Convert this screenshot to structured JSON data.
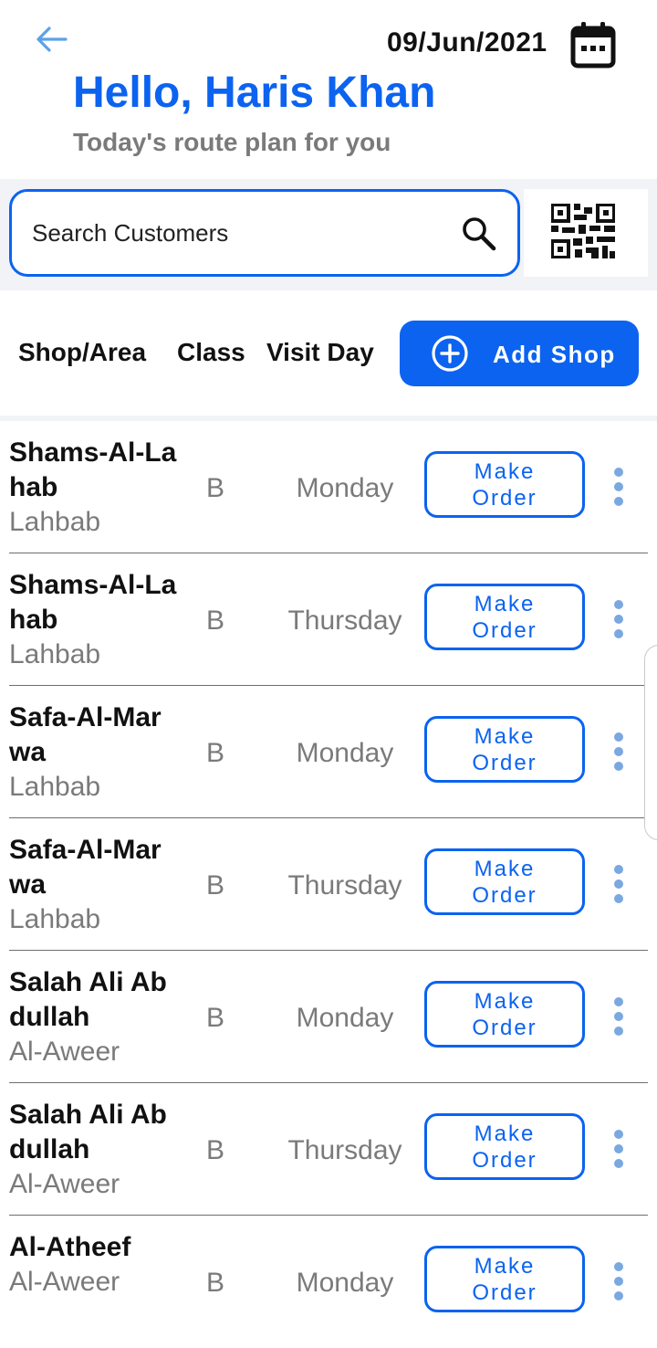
{
  "header": {
    "date": "09/Jun/2021",
    "greeting": "Hello, Haris Khan",
    "subtitle": "Today's route plan for you"
  },
  "search": {
    "placeholder": "Search Customers",
    "value": ""
  },
  "columns": {
    "shop": "Shop/Area",
    "class": "Class",
    "visit_day": "Visit Day"
  },
  "add_shop_label": "Add Shop",
  "colors": {
    "accent": "#0b63f0",
    "muted_text": "#7a7a7a",
    "band": "#f2f3f7",
    "kebab": "#7aa8e0"
  },
  "icons": [
    "back-arrow-icon",
    "calendar-icon",
    "search-icon",
    "qr-code-icon",
    "plus-circle-icon",
    "more-vertical-icon"
  ],
  "rows": [
    {
      "name": "Shams-Al-Lahab",
      "area": "Lahbab",
      "class": "B",
      "day": "Monday",
      "action": "Make\nOrder"
    },
    {
      "name": "Shams-Al-Lahab",
      "area": "Lahbab",
      "class": "B",
      "day": "Thursday",
      "action": "Make\nOrder"
    },
    {
      "name": "Safa-Al-Marwa",
      "area": "Lahbab",
      "class": "B",
      "day": "Monday",
      "action": "Make\nOrder"
    },
    {
      "name": "Safa-Al-Marwa",
      "area": "Lahbab",
      "class": "B",
      "day": "Thursday",
      "action": "Make\nOrder"
    },
    {
      "name": "Salah Ali Abdullah",
      "area": "Al-Aweer",
      "class": "B",
      "day": "Monday",
      "action": "Make\nOrder"
    },
    {
      "name": "Salah Ali Abdullah",
      "area": "Al-Aweer",
      "class": "B",
      "day": "Thursday",
      "action": "Make\nOrder"
    },
    {
      "name": "Al-Atheef",
      "area": "Al-Aweer",
      "class": "B",
      "day": "Monday",
      "action": "Make\nOrder"
    }
  ]
}
